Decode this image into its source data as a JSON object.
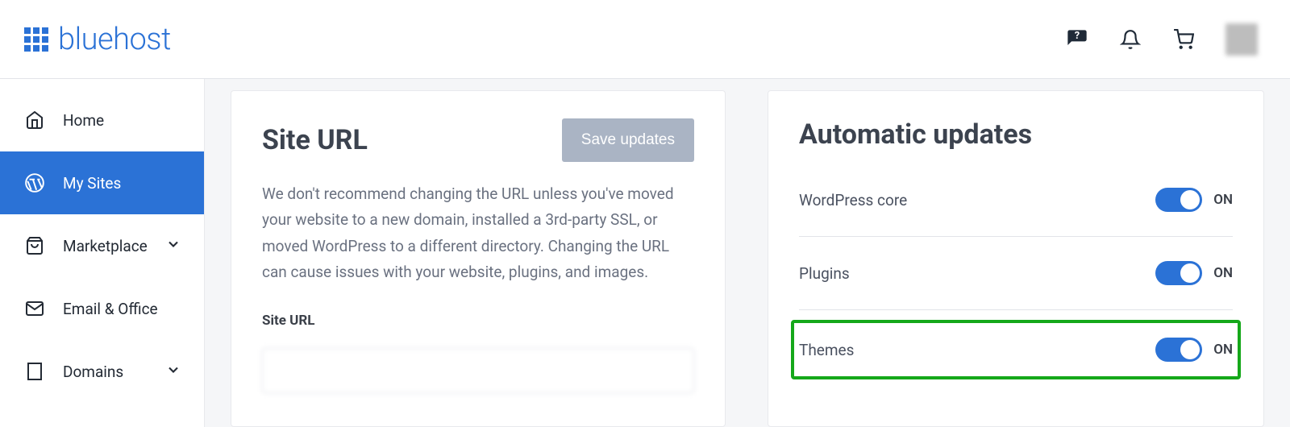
{
  "brand": "bluehost",
  "sidebar": {
    "items": [
      {
        "label": "Home"
      },
      {
        "label": "My Sites"
      },
      {
        "label": "Marketplace"
      },
      {
        "label": "Email & Office"
      },
      {
        "label": "Domains"
      }
    ]
  },
  "site_url_card": {
    "title": "Site URL",
    "save_label": "Save updates",
    "description": "We don't recommend changing the URL unless you've moved your website to a new domain, installed a 3rd-party SSL, or moved WordPress to a different directory. Changing the URL can cause issues with your website, plugins, and images.",
    "field_label": "Site URL",
    "field_value": ""
  },
  "auto_updates_card": {
    "title": "Automatic updates",
    "rows": [
      {
        "label": "WordPress core",
        "state": "ON"
      },
      {
        "label": "Plugins",
        "state": "ON"
      },
      {
        "label": "Themes",
        "state": "ON"
      }
    ]
  }
}
